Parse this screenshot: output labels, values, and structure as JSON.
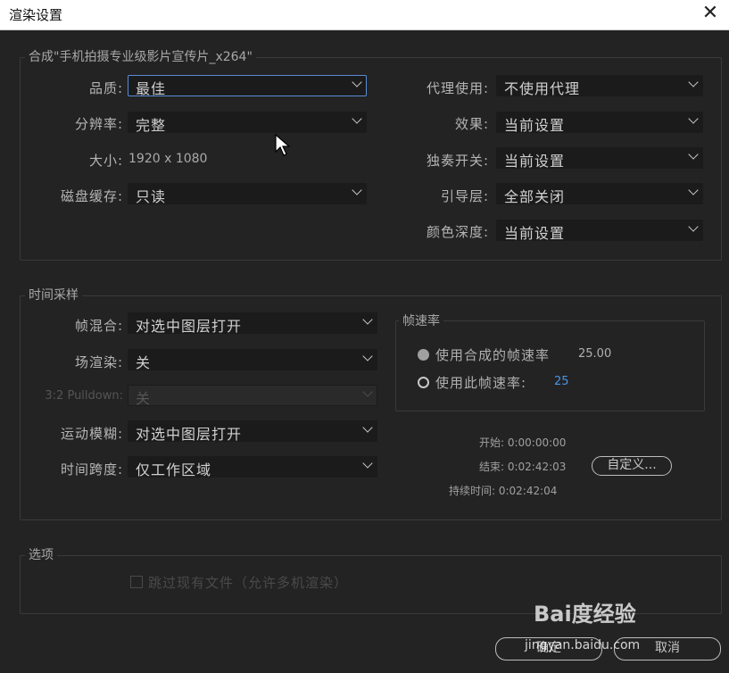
{
  "window": {
    "title": "渲染设置"
  },
  "composition": {
    "group_label": "合成\"手机拍摄专业级影片宣传片_x264\"",
    "quality": {
      "label": "品质:",
      "value": "最佳"
    },
    "resolution": {
      "label": "分辨率:",
      "value": "完整"
    },
    "size": {
      "label": "大小:",
      "value": "1920 x 1080"
    },
    "disk_cache": {
      "label": "磁盘缓存:",
      "value": "只读"
    },
    "proxy": {
      "label": "代理使用:",
      "value": "不使用代理"
    },
    "effects": {
      "label": "效果:",
      "value": "当前设置"
    },
    "solo": {
      "label": "独奏开关:",
      "value": "当前设置"
    },
    "guide": {
      "label": "引导层:",
      "value": "全部关闭"
    },
    "color_depth": {
      "label": "颜色深度:",
      "value": "当前设置"
    }
  },
  "time_sampling": {
    "group_label": "时间采样",
    "frame_blend": {
      "label": "帧混合:",
      "value": "对选中图层打开"
    },
    "field_render": {
      "label": "场渲染:",
      "value": "关"
    },
    "pulldown": {
      "label": "3:2 Pulldown:",
      "value": "关"
    },
    "motion_blur": {
      "label": "运动模糊:",
      "value": "对选中图层打开"
    },
    "time_span": {
      "label": "时间跨度:",
      "value": "仅工作区域"
    },
    "frame_rate": {
      "group_label": "帧速率",
      "use_comp": {
        "label": "使用合成的帧速率",
        "value": "25.00"
      },
      "use_this": {
        "label": "使用此帧速率:",
        "value": "25"
      }
    },
    "start": "开始: 0:00:00:00",
    "end": "结束: 0:02:42:03",
    "duration": "持续时间: 0:02:42:04",
    "custom_button": "自定义..."
  },
  "options": {
    "group_label": "选项",
    "skip_existing": "跳过现有文件（允许多机渲染）"
  },
  "footer": {
    "ok": "确定",
    "cancel": "取消"
  },
  "watermark": {
    "main": "Bai度经验",
    "sub": "jingyan.baidu.com"
  },
  "colors": {
    "background": "#232323",
    "dropdown": "#1b1b1b",
    "focus": "#5a8cd6",
    "link_blue": "#4a94e8"
  }
}
